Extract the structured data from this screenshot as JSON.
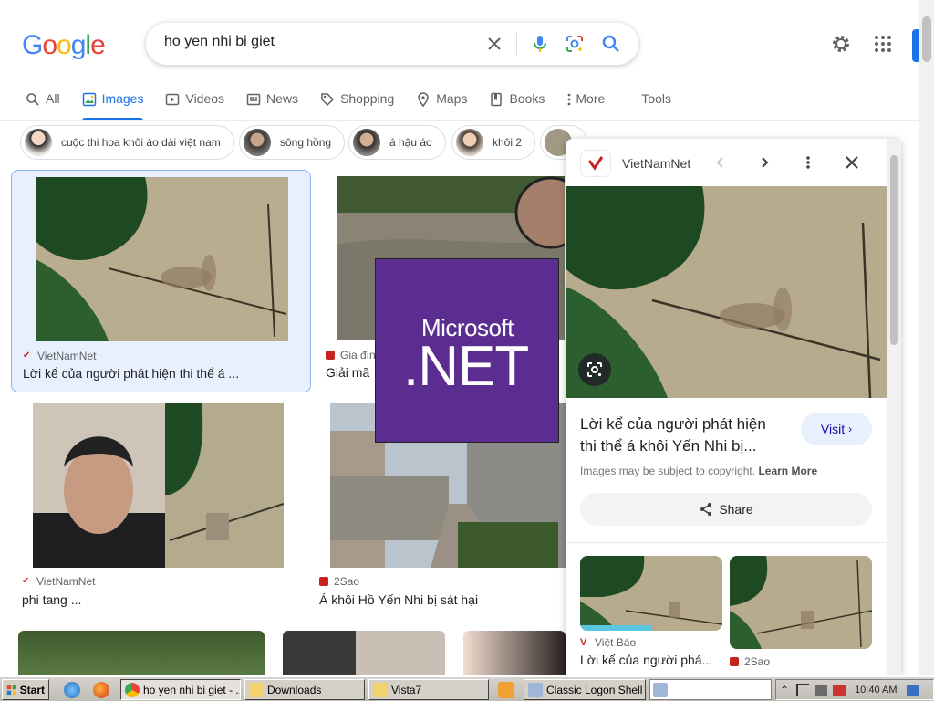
{
  "logo": {
    "text": "Google",
    "letters": [
      {
        "ch": "G",
        "color": "#4285F4"
      },
      {
        "ch": "o",
        "color": "#EA4335"
      },
      {
        "ch": "o",
        "color": "#FBBC05"
      },
      {
        "ch": "g",
        "color": "#4285F4"
      },
      {
        "ch": "l",
        "color": "#34A853"
      },
      {
        "ch": "e",
        "color": "#EA4335"
      }
    ]
  },
  "search": {
    "query": "ho yen nhi bi giet"
  },
  "tabs": [
    {
      "label": "All",
      "icon": "search-icon"
    },
    {
      "label": "Images",
      "icon": "image-icon",
      "active": true
    },
    {
      "label": "Videos",
      "icon": "play-icon"
    },
    {
      "label": "News",
      "icon": "news-icon"
    },
    {
      "label": "Shopping",
      "icon": "tag-icon"
    },
    {
      "label": "Maps",
      "icon": "map-pin-icon"
    },
    {
      "label": "Books",
      "icon": "book-icon"
    },
    {
      "label": "More",
      "icon": "more-vert-icon"
    },
    {
      "label": "Tools"
    }
  ],
  "chips": [
    {
      "label": "cuộc thi hoa khôi áo dài việt nam"
    },
    {
      "label": "sông hồng"
    },
    {
      "label": "á hậu áo"
    },
    {
      "label": "khôi 2"
    }
  ],
  "results": [
    {
      "source": "VietNamNet",
      "title": "Lời kể của người phát hiện thi thể á ...",
      "selected": true
    },
    {
      "source": "Gia đìn",
      "title": "Giải mã"
    },
    {
      "source": "VietNamNet",
      "title": "phi tang ..."
    },
    {
      "source": "2Sao",
      "title": "Á khôi Hồ Yến Nhi bị sát hại"
    }
  ],
  "overlay": {
    "line1": "Microsoft",
    "line2": ".NET"
  },
  "panel": {
    "site": "VietNamNet",
    "title": "Lời kể của người phát hiện thi thể á khôi Yến Nhi bị...",
    "visit_label": "Visit",
    "copyright": "Images may be subject to copyright.",
    "learn_more": "Learn More",
    "share_label": "Share",
    "related": [
      {
        "source": "Việt Báo",
        "title": "Lời kể của người phá..."
      },
      {
        "source": "2Sao",
        "title": ""
      }
    ]
  },
  "taskbar": {
    "start": "Start",
    "items": [
      {
        "label": "ho yen nhi bi giet - ...",
        "pressed": true
      },
      {
        "label": "Downloads"
      },
      {
        "label": "Vista7"
      },
      {
        "label": "Classic Logon Shell ..."
      }
    ],
    "clock": "10:40 AM"
  },
  "colors": {
    "accent": "#1a73e8",
    "net_purple": "#5c2d91"
  }
}
